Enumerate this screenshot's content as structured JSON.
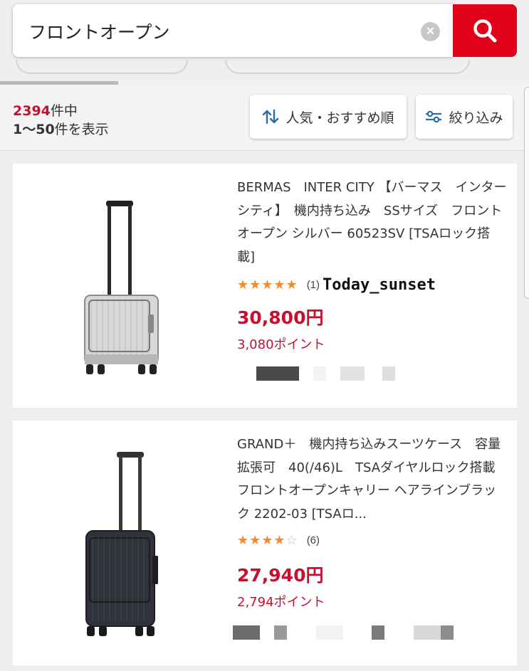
{
  "search": {
    "query": "フロントオープン",
    "clear_icon": "close-circle-icon",
    "search_icon": "search-icon"
  },
  "results": {
    "total": "2394",
    "total_suffix": "件中",
    "range": "1〜50",
    "range_suffix": "件を表示"
  },
  "toolbar": {
    "sort_label": "人気・おすすめ順",
    "sort_icon": "sort-arrows-icon",
    "filter_label": "絞り込み",
    "filter_icon": "sliders-icon"
  },
  "colors": {
    "brand_red": "#e0001a",
    "price_red": "#c8102e",
    "star_orange": "#f08c2b"
  },
  "products": [
    {
      "title": "BERMAS　INTER CITY 【バーマス　インターシティ】　機内持ち込み　SSサイズ　フロントオープン シルバー 60523SV [TSAロック搭載]",
      "rating": 5,
      "review_count": "(1)",
      "price": "30,800円",
      "points": "3,080ポイント",
      "overlay_text": "Today_sunset",
      "image": "silver-suitcase"
    },
    {
      "title": "GRAND＋　機内持ち込みスーツケース　容量拡張可　40(/46)L　TSAダイヤルロック搭載 フロントオープンキャリー ヘアラインブラック 2202-03 [TSAロ...",
      "rating": 4,
      "review_count": "(6)",
      "price": "27,940円",
      "points": "2,794ポイント",
      "image": "black-suitcase"
    }
  ]
}
